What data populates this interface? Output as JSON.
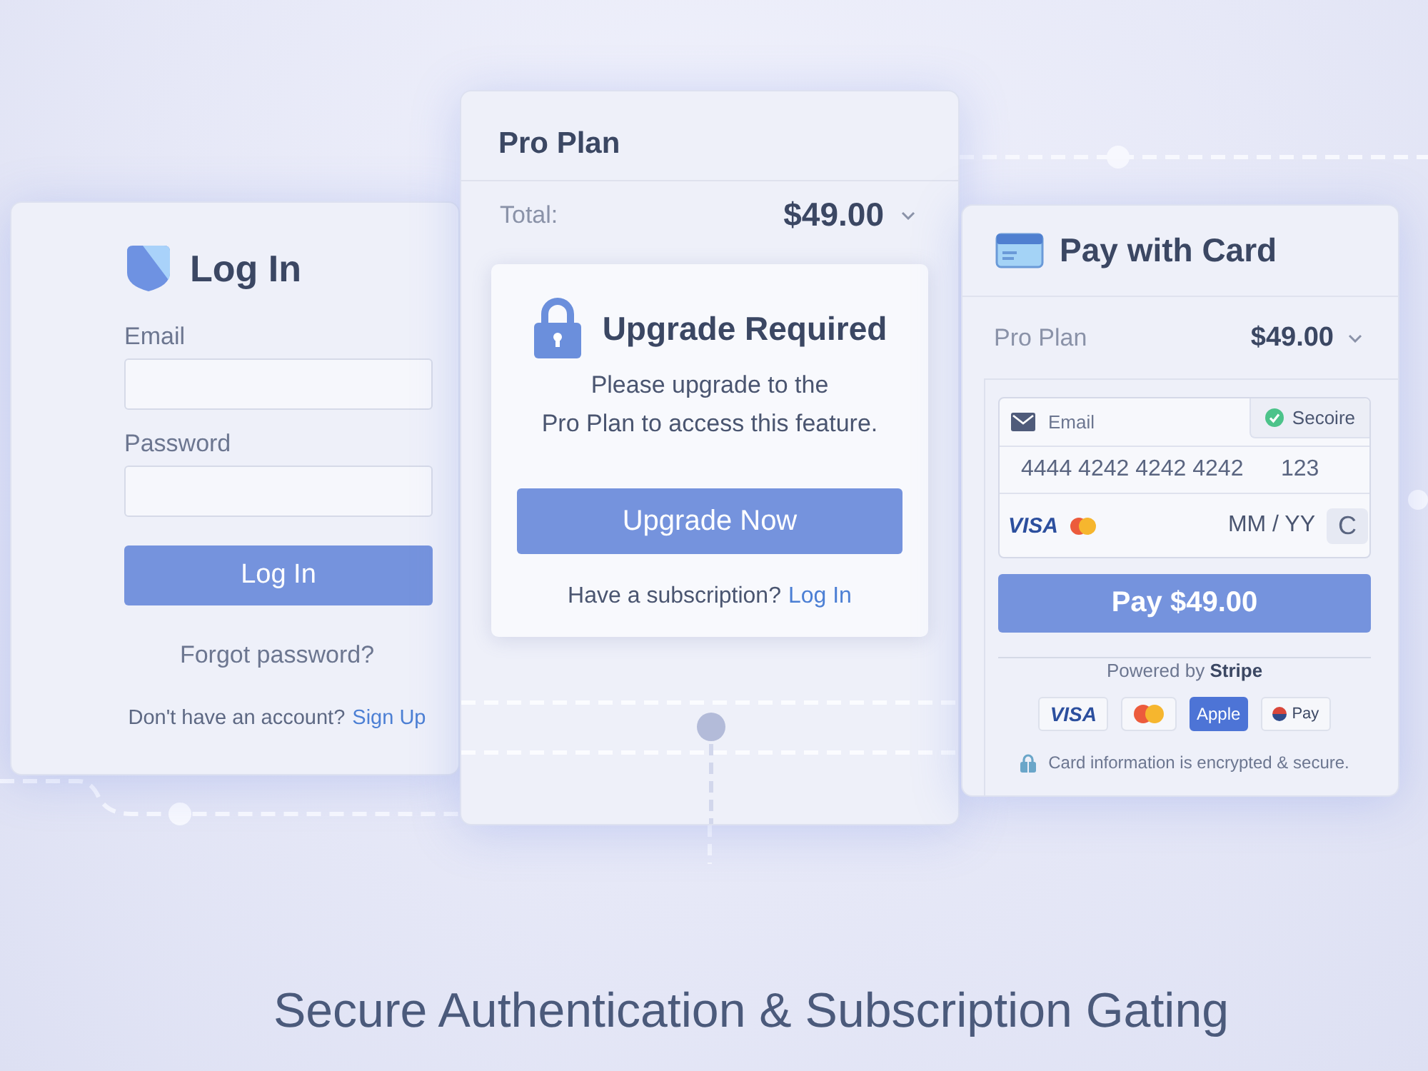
{
  "login_card": {
    "title": "Log In",
    "fields": [
      {
        "label": "Email"
      },
      {
        "label": "Password"
      }
    ],
    "submit_button": "Log In",
    "forgot_link": "Forgot password?",
    "signup_prompt": "Don't have an account?",
    "signup_link": "Sign Up"
  },
  "plan_card": {
    "title": "Pro Plan",
    "total_label": "Total:",
    "total_amount": "$49.00",
    "gate": {
      "title": "Upgrade Required",
      "message": "Please upgrade to the\nPro Plan to access this feature.",
      "button": "Upgrade Now",
      "login_prompt": "Have a subscription?",
      "login_link": "Log In"
    }
  },
  "payment_card": {
    "title": "Pay with Card",
    "plan_name": "Pro Plan",
    "plan_price": "$49.00",
    "form": {
      "email_placeholder": "Email",
      "secure_badge": "Secoire",
      "card_number": "4444 4242 4242 4242",
      "cvc": "123",
      "card_brand": "VISA",
      "expiry_placeholder": "MM / YY",
      "reset_key": "C"
    },
    "pay_button": "Pay $49.00",
    "powered_by": "Powered by **Stripe**",
    "payment_methods": [
      {
        "kind": "visa",
        "label": "VISA"
      },
      {
        "kind": "mastercard"
      },
      {
        "kind": "apple",
        "label": "Apple"
      },
      {
        "kind": "pay",
        "label": "Pay"
      }
    ],
    "footnote": "Card information is encrypted & secure."
  },
  "caption": "Secure Authentication & Subscription Gating"
}
